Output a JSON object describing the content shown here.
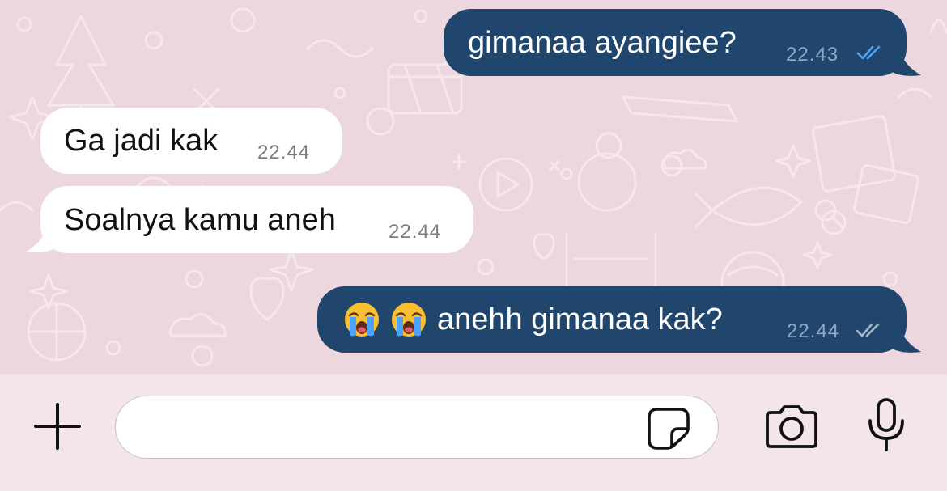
{
  "messages": [
    {
      "direction": "outgoing",
      "text": "gimanaa ayangiee?",
      "time": "22.43",
      "status": "read"
    },
    {
      "direction": "incoming",
      "text": "Ga jadi kak",
      "time": "22.44"
    },
    {
      "direction": "incoming",
      "text": "Soalnya kamu aneh",
      "time": "22.44"
    },
    {
      "direction": "outgoing",
      "emojis": [
        "crying-face-emoji",
        "crying-face-emoji"
      ],
      "text": "anehh gimanaa kak?",
      "time": "22.44",
      "status": "delivered"
    }
  ],
  "input_bar": {
    "placeholder": "",
    "value": "",
    "icons": [
      "plus-icon",
      "sticker-icon",
      "camera-icon",
      "microphone-icon"
    ]
  },
  "colors": {
    "chat_background": "#ecd7df",
    "outgoing_bubble": "#20466e",
    "incoming_bubble": "#ffffff",
    "read_ticks": "#4fa3f0",
    "delivered_ticks": "#a9b8c9",
    "input_bar_background": "#f3e5eb"
  }
}
